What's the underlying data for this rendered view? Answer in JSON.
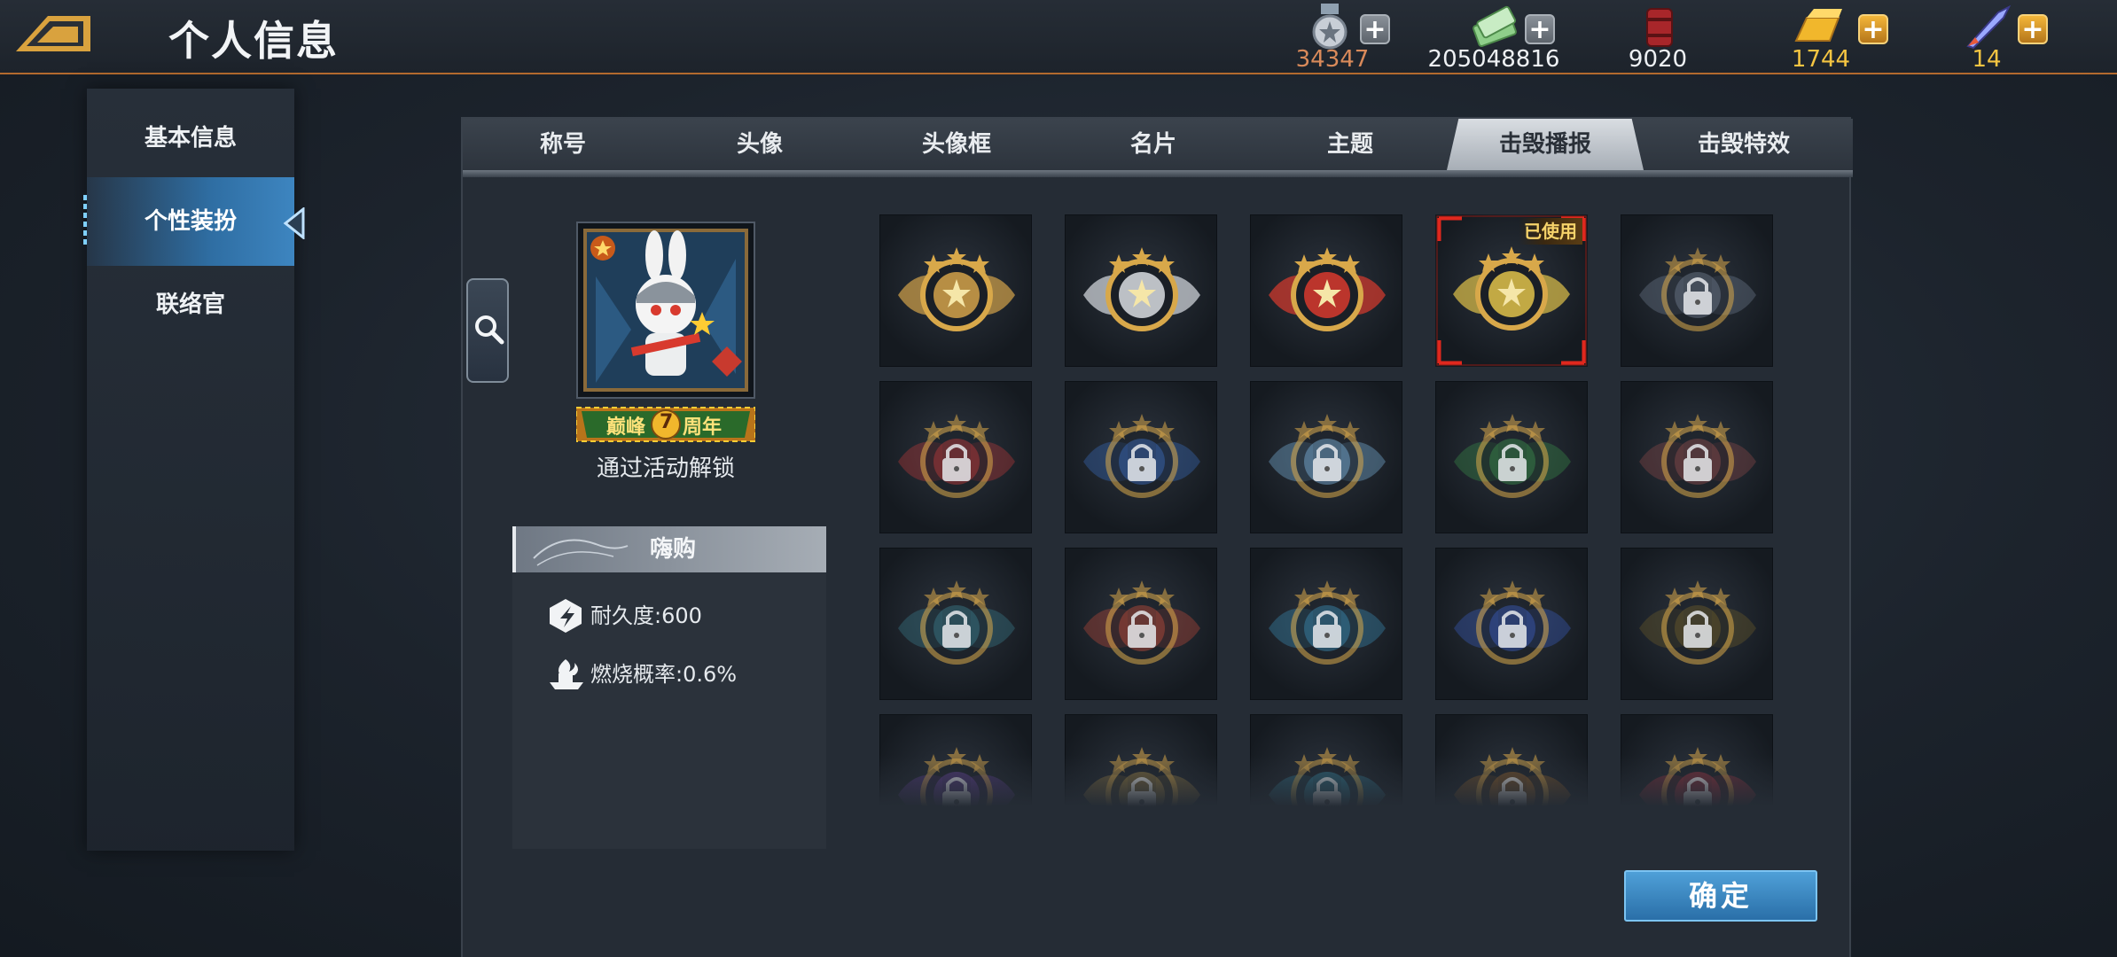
{
  "header": {
    "title": "个人信息",
    "resources": [
      {
        "name": "medal",
        "icon": "medal-icon",
        "value": "34347",
        "color": "#d98a5a",
        "plus": "gray"
      },
      {
        "name": "cash",
        "icon": "cash-icon",
        "value": "205048816",
        "color": "#eef1f4",
        "plus": "gray"
      },
      {
        "name": "oil",
        "icon": "oil-barrel-icon",
        "value": "9020",
        "color": "#eef1f4",
        "plus": ""
      },
      {
        "name": "gold",
        "icon": "gold-bar-icon",
        "value": "1744",
        "color": "#f5c542",
        "plus": "gold"
      },
      {
        "name": "rocket",
        "icon": "rocket-icon",
        "value": "14",
        "color": "#f5c542",
        "plus": "gold"
      }
    ],
    "plus_label": "+"
  },
  "sidebar": {
    "items": [
      {
        "label": "基本信息"
      },
      {
        "label": "个性装扮",
        "active": true
      },
      {
        "label": "联络官"
      }
    ]
  },
  "tabs": [
    {
      "label": "称号"
    },
    {
      "label": "头像"
    },
    {
      "label": "头像框"
    },
    {
      "label": "名片"
    },
    {
      "label": "主题"
    },
    {
      "label": "击毁播报",
      "active": true
    },
    {
      "label": "击毁特效"
    }
  ],
  "preview": {
    "badge_text_left": "巅峰",
    "badge_number": "7",
    "badge_text_right": "周年",
    "unlock_hint": "通过活动解锁"
  },
  "info": {
    "title": "嗨购",
    "durability": "耐久度:600",
    "burn_rate": "燃烧概率:0.6%"
  },
  "grid": {
    "used_label": "已使用",
    "items": [
      {
        "locked": false,
        "accent": "#d3a24a"
      },
      {
        "locked": false,
        "accent": "#d9dde2"
      },
      {
        "locked": false,
        "accent": "#d83a2e"
      },
      {
        "locked": false,
        "accent": "#e0c24a",
        "used": true
      },
      {
        "locked": true,
        "accent": "#6d7a8c"
      },
      {
        "locked": true,
        "accent": "#b83a3a"
      },
      {
        "locked": true,
        "accent": "#3a6ab8"
      },
      {
        "locked": true,
        "accent": "#7ab0d8"
      },
      {
        "locked": true,
        "accent": "#3a8a4a"
      },
      {
        "locked": true,
        "accent": "#8a4a4a"
      },
      {
        "locked": true,
        "accent": "#3a7a8a"
      },
      {
        "locked": true,
        "accent": "#b84a3a"
      },
      {
        "locked": true,
        "accent": "#3a8ab0"
      },
      {
        "locked": true,
        "accent": "#3a5ab8"
      },
      {
        "locked": true,
        "accent": "#6a5a2a"
      },
      {
        "locked": true,
        "accent": "#7a4ab8"
      },
      {
        "locked": true,
        "accent": "#c8a04a"
      },
      {
        "locked": true,
        "accent": "#3a9ab8"
      },
      {
        "locked": true,
        "accent": "#b8742a"
      },
      {
        "locked": true,
        "accent": "#c83a4a"
      }
    ]
  },
  "confirm_label": "确定"
}
